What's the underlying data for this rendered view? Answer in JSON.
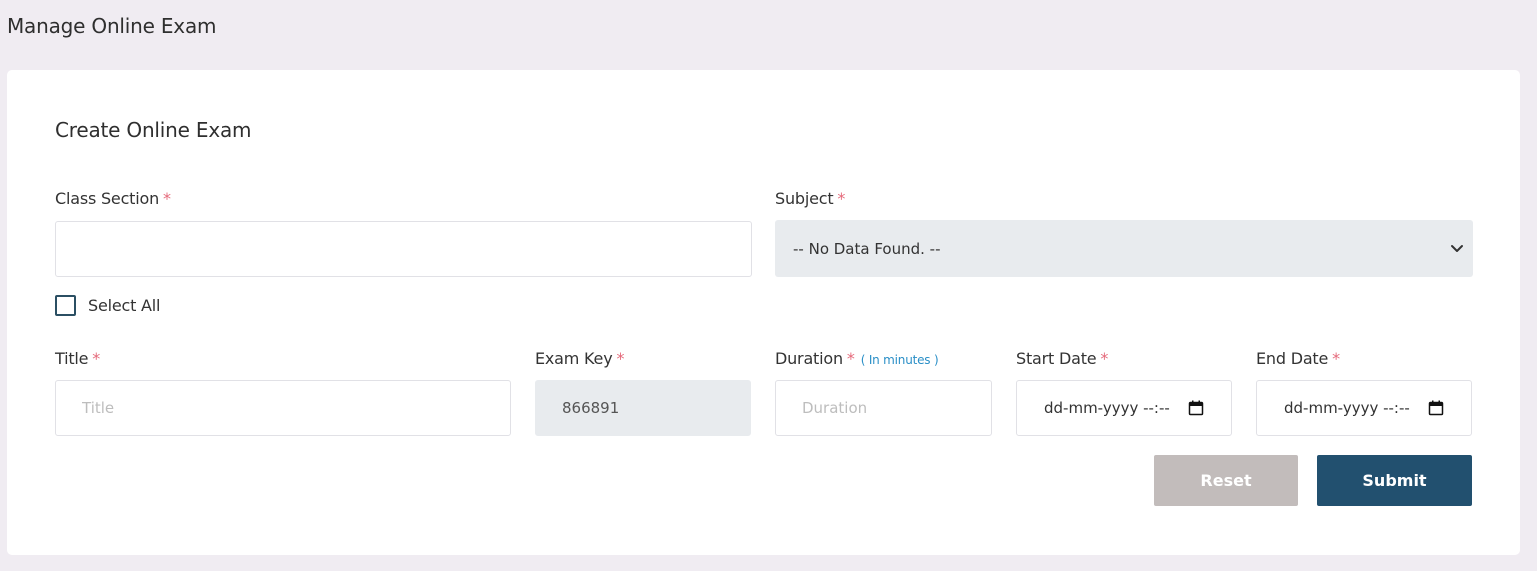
{
  "page": {
    "title": "Manage Online Exam"
  },
  "form": {
    "title": "Create Online Exam",
    "required_mark": "*",
    "class_section": {
      "label": "Class Section",
      "value": ""
    },
    "subject": {
      "label": "Subject",
      "selected": "-- No Data Found. --"
    },
    "select_all": {
      "label": "Select All",
      "checked": false
    },
    "title_field": {
      "label": "Title",
      "placeholder": "Title",
      "value": ""
    },
    "exam_key": {
      "label": "Exam Key",
      "value": "866891"
    },
    "duration": {
      "label": "Duration",
      "hint": "( In minutes )",
      "placeholder": "Duration",
      "value": ""
    },
    "start_date": {
      "label": "Start Date",
      "value": "dd-mm-yyyy --:--"
    },
    "end_date": {
      "label": "End Date",
      "value": "dd-mm-yyyy --:--"
    },
    "buttons": {
      "reset": "Reset",
      "submit": "Submit"
    }
  },
  "icons": {
    "subject_dropdown": "chevron-down-icon",
    "date_picker": "calendar-icon"
  },
  "colors": {
    "page_background": "#f0ecf2",
    "required": "#e5697a",
    "hint": "#2a8fc7",
    "primary": "#22506f",
    "reset": "#c2bcbb",
    "readonly_background": "#e8ebee"
  }
}
